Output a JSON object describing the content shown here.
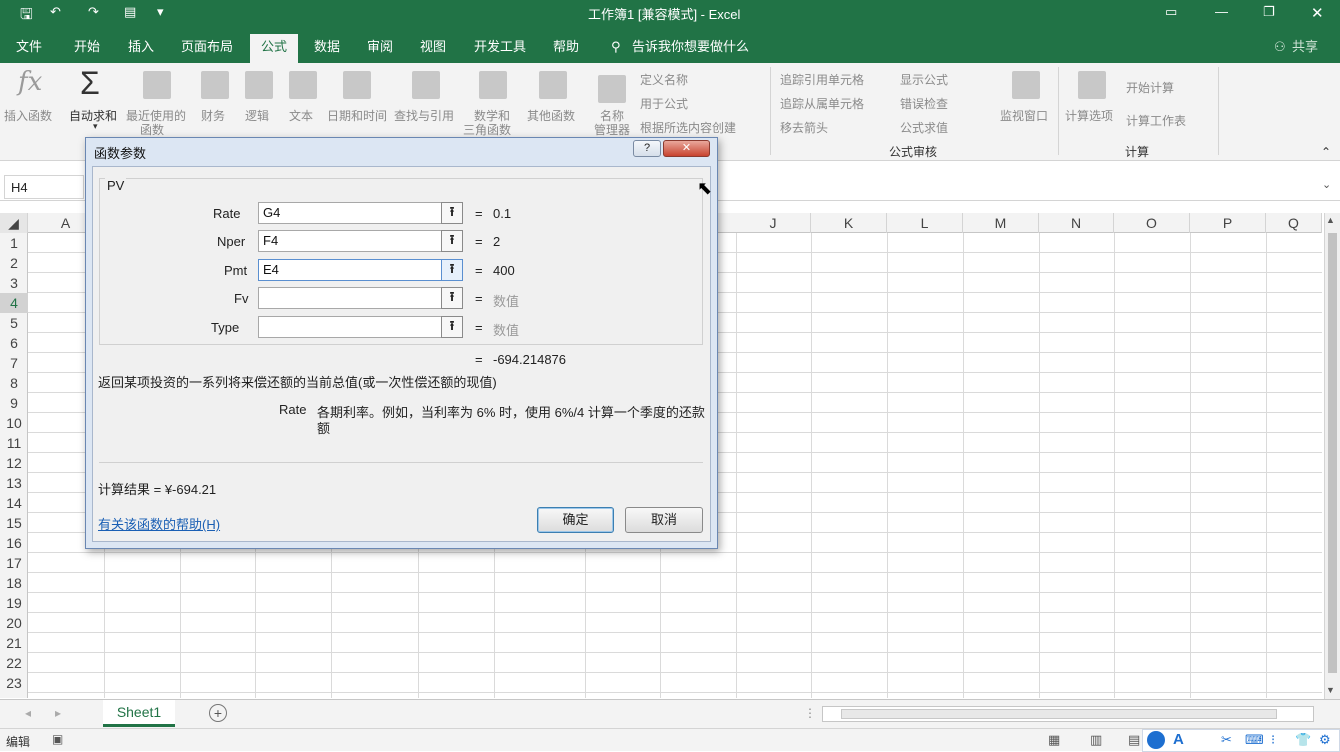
{
  "app": {
    "title": "工作簿1  [兼容模式]  -  Excel"
  },
  "ribbon_tabs": [
    "文件",
    "开始",
    "插入",
    "页面布局",
    "公式",
    "数据",
    "审阅",
    "视图",
    "开发工具",
    "帮助"
  ],
  "tell_me": "告诉我你想要做什么",
  "share": "共享",
  "ribbon": {
    "insert_function": "插入函数",
    "autosum": "自动求和",
    "recent_1": "最近使用的",
    "recent_2": "函数",
    "financial": "财务",
    "logical": "逻辑",
    "text": "文本",
    "datetime": "日期和时间",
    "lookup": "查找与引用",
    "math_1": "数学和",
    "math_2": "三角函数",
    "other": "其他函数",
    "name_mgr_1": "名称",
    "name_mgr_2": "管理器",
    "define_name": "定义名称",
    "use_in_formula": "用于公式",
    "create_from_sel": "根据所选内容创建",
    "trace_prec": "追踪引用单元格",
    "trace_dep": "追踪从属单元格",
    "remove_arrows": "移去箭头",
    "show_formulas": "显示公式",
    "error_check": "错误检查",
    "eval_formula": "公式求值",
    "watch": "监视窗口",
    "calc_options": "计算选项",
    "calc_now": "开始计算",
    "calc_sheet": "计算工作表",
    "group_audit": "公式审核",
    "group_calc": "计算"
  },
  "name_box": "H4",
  "columns": [
    "A",
    "J",
    "K",
    "L",
    "M",
    "N",
    "O",
    "P",
    "Q"
  ],
  "rows": [
    "1",
    "2",
    "3",
    "4",
    "5",
    "6",
    "7",
    "8",
    "9",
    "10",
    "11",
    "12",
    "13",
    "14",
    "15",
    "16",
    "17",
    "18",
    "19",
    "20",
    "21",
    "22",
    "23"
  ],
  "sheet_tab": "Sheet1",
  "status_mode": "编辑",
  "dialog": {
    "title": "函数参数",
    "function_name": "PV",
    "args": [
      {
        "label": "Rate",
        "value": "G4",
        "result": "0.1"
      },
      {
        "label": "Nper",
        "value": "F4",
        "result": "2"
      },
      {
        "label": "Pmt",
        "value": "E4",
        "result": "400"
      },
      {
        "label": "Fv",
        "value": "",
        "result": "数值"
      },
      {
        "label": "Type",
        "value": "",
        "result": "数值"
      }
    ],
    "eq": "=",
    "formula_result": "-694.214876",
    "description": "返回某项投资的一系列将来偿还额的当前总值(或一次性偿还额的现值)",
    "arg_name": "Rate",
    "arg_help_1": "各期利率。例如，当利率为 6% 时，使用 6%/4 计算一个季度的还款",
    "arg_help_2": "额",
    "calc_result": "计算结果 =   ¥-694.21",
    "help_link": "有关该函数的帮助(H)",
    "ok": "确定",
    "cancel": "取消"
  }
}
